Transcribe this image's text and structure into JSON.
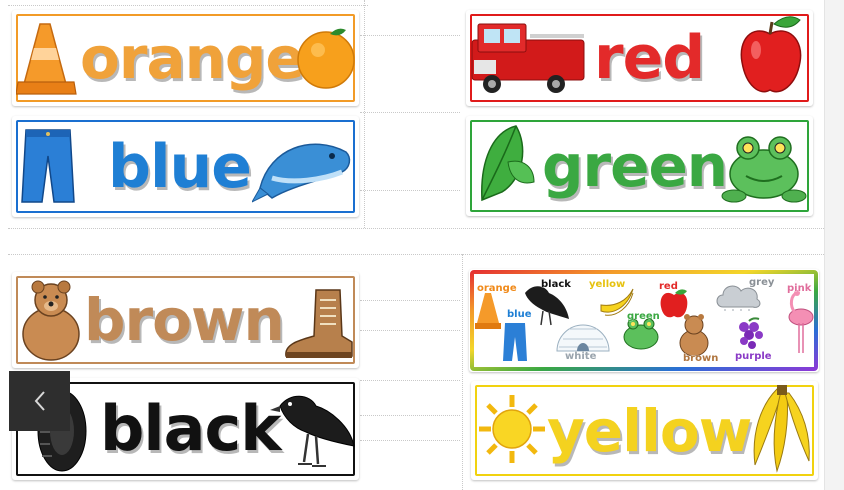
{
  "cards": {
    "orange": {
      "word": "orange",
      "color": "#f0a23a",
      "border": "#f29b27"
    },
    "red": {
      "word": "red",
      "color": "#e32a2a",
      "border": "#e01b1b"
    },
    "blue": {
      "word": "blue",
      "color": "#1f7fd4",
      "border": "#1a6fd0"
    },
    "green": {
      "word": "green",
      "color": "#3aa842",
      "border": "#2ea53a"
    },
    "brown": {
      "word": "brown",
      "color": "#c08a58",
      "border": "#c08a58"
    },
    "black": {
      "word": "black",
      "color": "#111111",
      "border": "#111111"
    },
    "yellow": {
      "word": "yellow",
      "color": "#f4d21f",
      "border": "#f1d20f"
    }
  },
  "chart": {
    "labels": {
      "orange": "orange",
      "black": "black",
      "yellow": "yellow",
      "red": "red",
      "grey": "grey",
      "pink": "pink",
      "blue": "blue",
      "green": "green",
      "white": "white",
      "brown": "brown",
      "purple": "purple"
    }
  },
  "nav": {
    "prev_icon": "chevron-left-icon"
  }
}
